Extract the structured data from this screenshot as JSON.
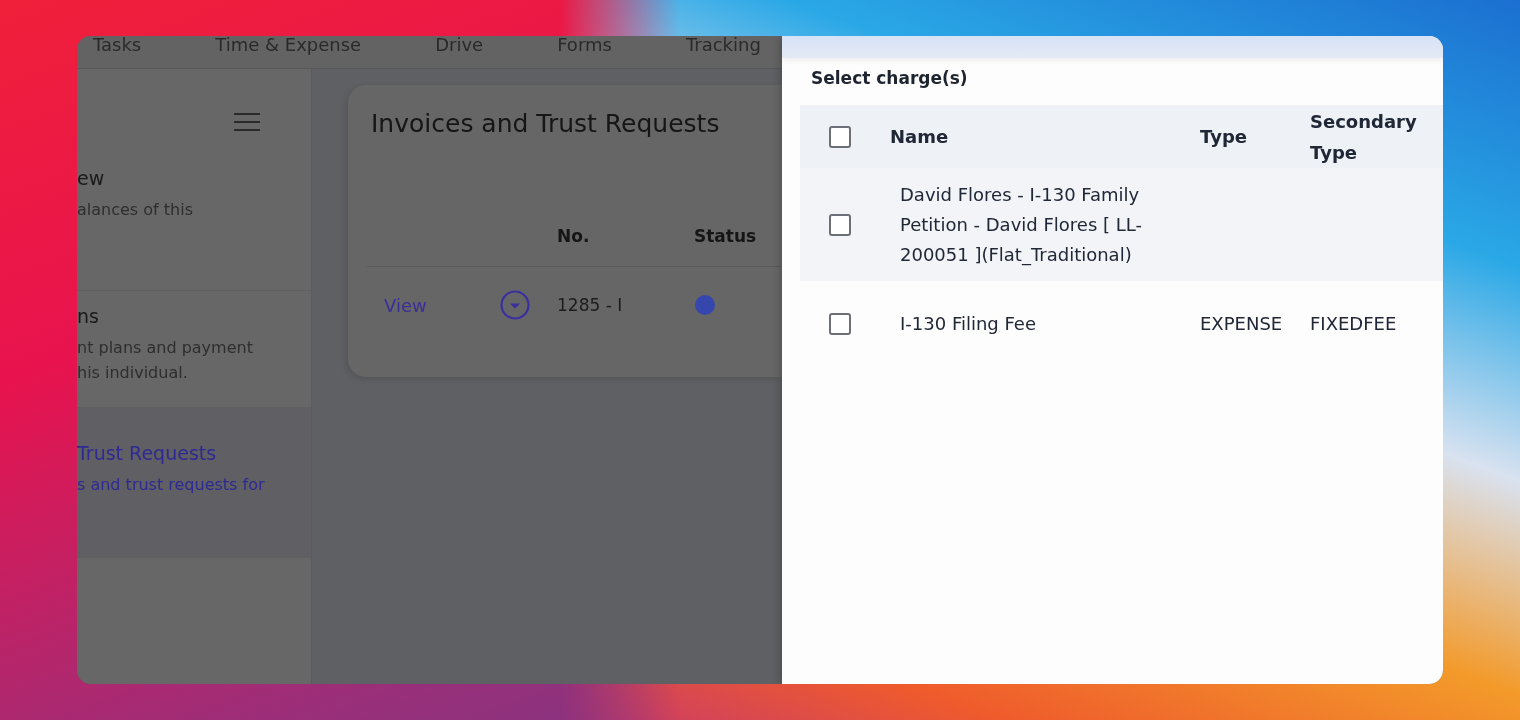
{
  "app_tabs": [
    {
      "label": "Tasks",
      "selected": false
    },
    {
      "label": "Time & Expense",
      "selected": false
    },
    {
      "label": "Drive",
      "selected": false
    },
    {
      "label": "Forms",
      "selected": false
    },
    {
      "label": "Tracking",
      "selected": false
    }
  ],
  "sidebar": {
    "items": [
      {
        "title": "ew",
        "description": "alances of this",
        "selected": false
      },
      {
        "title": "ns",
        "description": "nt plans and payment his individual.",
        "selected": false
      },
      {
        "title": "Trust Requests",
        "description": "s and trust requests for",
        "selected": true
      }
    ]
  },
  "main": {
    "title": "Invoices and Trust Requests",
    "table": {
      "columns": [
        "No.",
        "Status"
      ],
      "rows": [
        {
          "link": "View",
          "number": "1285 - I",
          "color": "#3547ad"
        }
      ]
    }
  },
  "drawer": {
    "label": "Select charge(s)",
    "table": {
      "all_checked": false,
      "columns": [
        "Name",
        "Type",
        "Secondary Type"
      ],
      "rows": [
        {
          "name": "David Flores - I-130 Family Petition - David Flores [ LL-200051 ](Flat_Traditional)",
          "checked": false,
          "hovered": true
        },
        {
          "name": "I-130 Filing Fee",
          "type": "EXPENSE",
          "secondary_type": "FIXEDFEE",
          "checked": false,
          "hovered": false
        }
      ]
    }
  }
}
